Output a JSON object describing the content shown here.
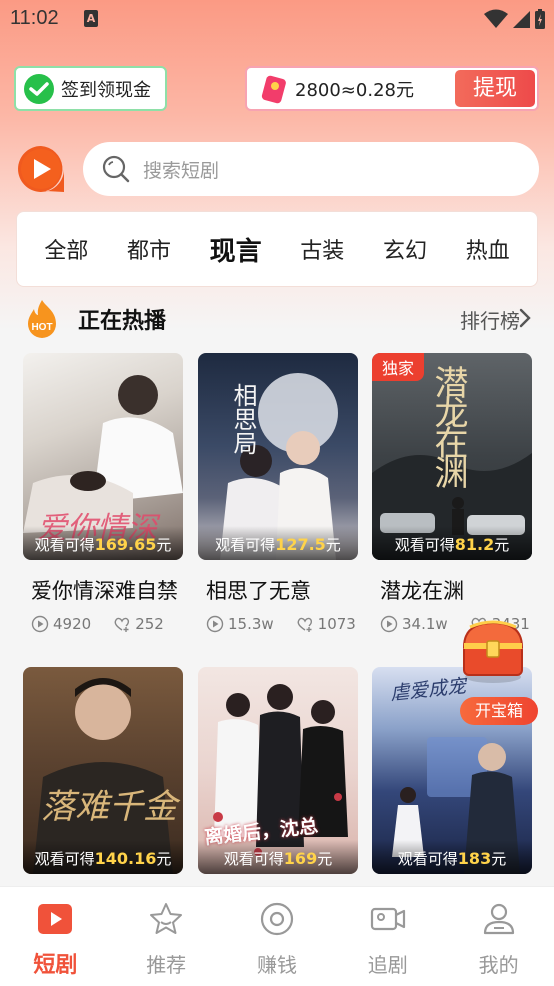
{
  "status_bar": {
    "time": "11:02",
    "notif": "A"
  },
  "signin": {
    "label": "签到领现金"
  },
  "coins": {
    "text": "2800≈0.28元",
    "withdraw_label": "提现"
  },
  "search": {
    "placeholder": "搜索短剧"
  },
  "categories": [
    "全部",
    "都市",
    "现言",
    "古装",
    "玄幻",
    "热血"
  ],
  "active_category": "现言",
  "hot": {
    "title": "正在热播",
    "icon_text": "HOT",
    "ranking_label": "排行榜"
  },
  "earn_prefix": "观看可得",
  "earn_suffix": "元",
  "dramas": [
    {
      "title": "爱你情深难自禁",
      "earn": "169.65",
      "views": "4920",
      "likes": "252",
      "badge": "",
      "poster_text": "爱你情深"
    },
    {
      "title": "相思了无意",
      "earn": "127.5",
      "views": "15.3w",
      "likes": "1073",
      "badge": "",
      "poster_text": "相思局"
    },
    {
      "title": "潜龙在渊",
      "earn": "81.2",
      "views": "34.1w",
      "likes": "3431",
      "badge": "独家",
      "poster_text": "潜龙在渊"
    },
    {
      "title": "",
      "earn": "140.16",
      "views": "",
      "likes": "",
      "badge": "",
      "poster_text": "落难千金"
    },
    {
      "title": "",
      "earn": "169",
      "views": "",
      "likes": "",
      "badge": "",
      "poster_text": "离婚后，沈总"
    },
    {
      "title": "",
      "earn": "183",
      "views": "",
      "likes": "",
      "badge": "",
      "poster_text": "虐爱成宠"
    }
  ],
  "treasure": {
    "label": "开宝箱"
  },
  "nav": [
    {
      "label": "短剧",
      "icon": "play-square-icon",
      "active": true
    },
    {
      "label": "推荐",
      "icon": "star-icon",
      "active": false
    },
    {
      "label": "赚钱",
      "icon": "coin-icon",
      "active": false
    },
    {
      "label": "追剧",
      "icon": "video-camera-icon",
      "active": false
    },
    {
      "label": "我的",
      "icon": "user-icon",
      "active": false
    }
  ],
  "colors": {
    "accent": "#f0523a",
    "earn": "#ffd34a",
    "badge": "#ec3f2f",
    "signin_green": "#27c04a"
  }
}
